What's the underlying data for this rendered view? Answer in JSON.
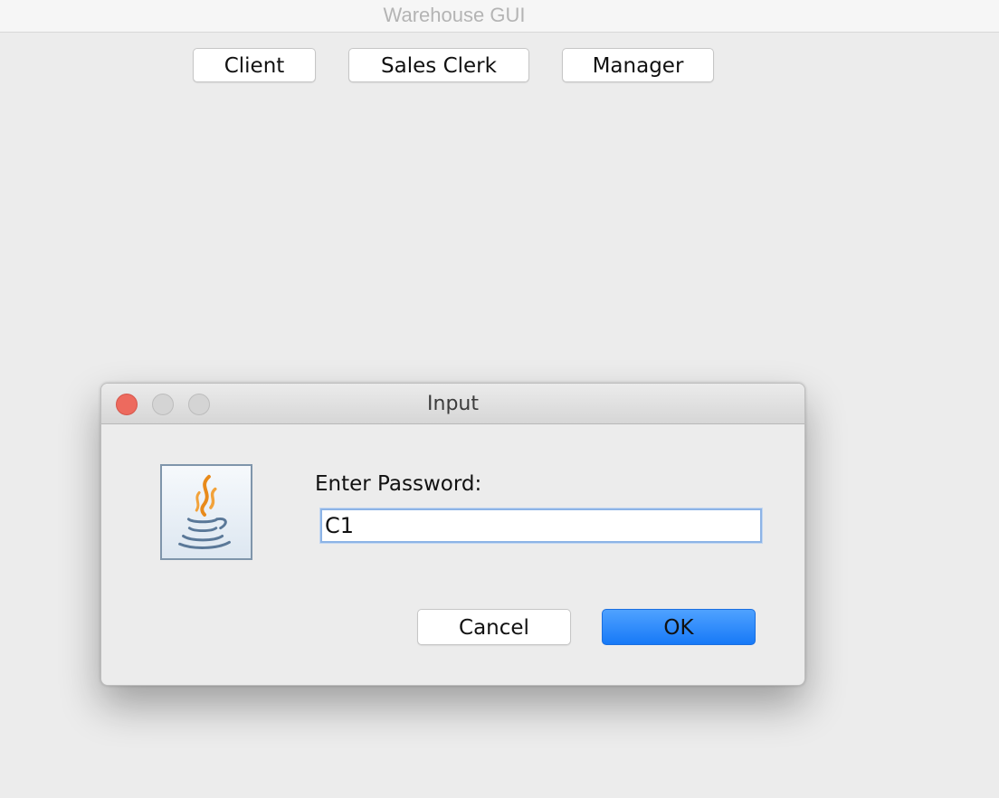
{
  "main_window": {
    "title": "Warehouse GUI",
    "buttons": {
      "client": "Client",
      "sales_clerk": "Sales Clerk",
      "manager": "Manager"
    }
  },
  "dialog": {
    "title": "Input",
    "icon": "java-coffee-cup-icon",
    "prompt": "Enter Password:",
    "password_value": "C1",
    "buttons": {
      "cancel": "Cancel",
      "ok": "OK"
    }
  },
  "colors": {
    "ok_button": "#1779f7",
    "close_button": "#ed6a5e",
    "input_focus_ring": "#8db4e6"
  }
}
